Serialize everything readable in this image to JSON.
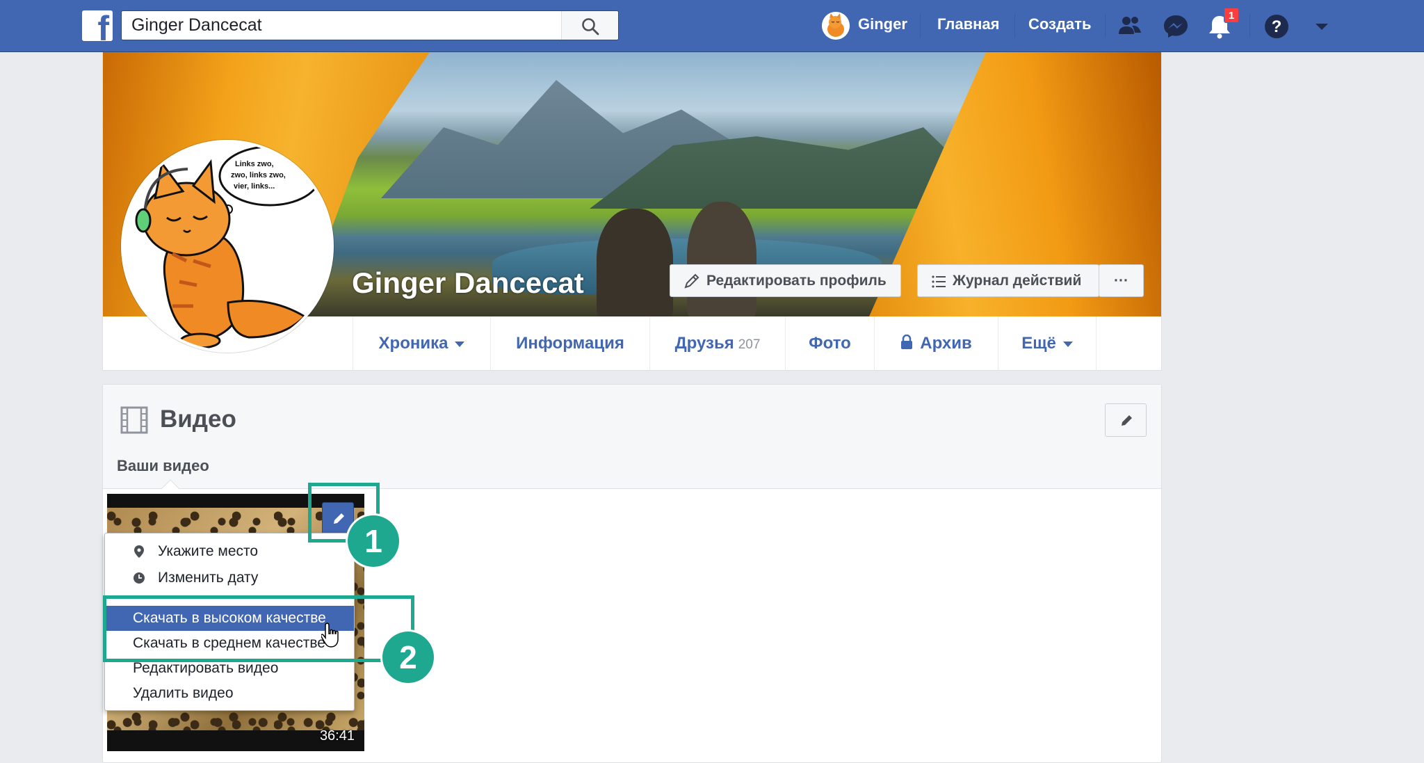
{
  "topbar": {
    "search": {
      "value": "Ginger Dancecat",
      "placeholder": ""
    },
    "user_name": "Ginger",
    "links": {
      "home": "Главная",
      "create": "Создать"
    },
    "notifications_count": "1"
  },
  "profile": {
    "name": "Ginger Dancecat",
    "speech_bubble": "Links zwo, zwo, links zwo, vier, links...",
    "edit_profile_label": "Редактировать профиль",
    "activity_log_label": "Журнал действий",
    "more_dots": "···",
    "tabs": [
      {
        "label": "Хроника",
        "count": ""
      },
      {
        "label": "Информация",
        "count": ""
      },
      {
        "label": "Друзья",
        "count": "207"
      },
      {
        "label": "Фото",
        "count": ""
      },
      {
        "label": "Архив",
        "count": ""
      },
      {
        "label": "Ещё",
        "count": ""
      }
    ]
  },
  "videos": {
    "title": "Видео",
    "section_label": "Ваши видео",
    "items": [
      {
        "duration": "36:41"
      }
    ],
    "menu": {
      "items": [
        {
          "label": "Укажите место",
          "icon": "location-pin-icon"
        },
        {
          "label": "Изменить дату",
          "icon": "clock-icon"
        },
        {
          "label": "Скачать в высоком качестве",
          "icon": ""
        },
        {
          "label": "Скачать в среднем качестве",
          "icon": ""
        },
        {
          "label": "Редактировать видео",
          "icon": ""
        },
        {
          "label": "Удалить видео",
          "icon": ""
        }
      ],
      "highlighted_index": 2
    }
  },
  "annotations": {
    "step1": "1",
    "step2": "2",
    "color": "#1ea88f"
  },
  "colors": {
    "brand_blue": "#4267b2",
    "page_bg": "#e9ebee",
    "badge_red": "#fa3e3e"
  }
}
